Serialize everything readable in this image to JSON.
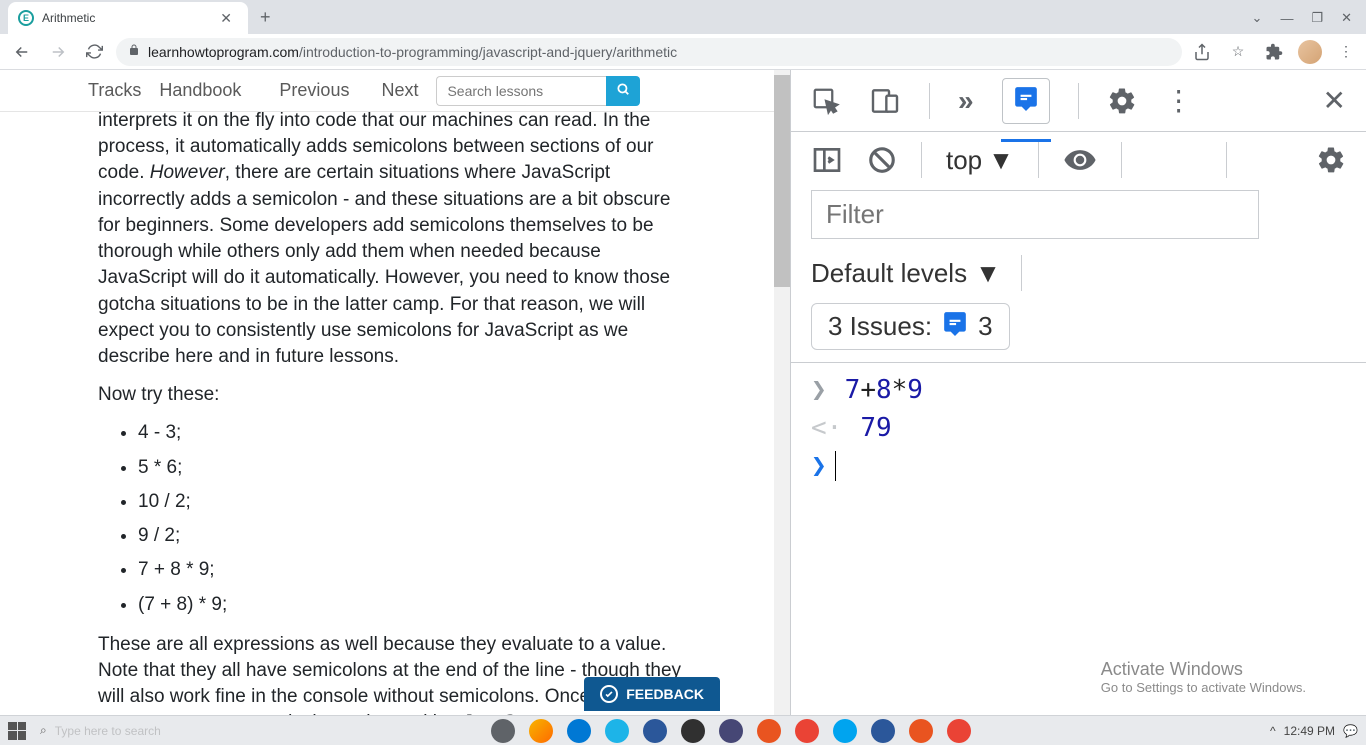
{
  "browser": {
    "tab_title": "Arithmetic",
    "url_domain": "learnhowtoprogram.com",
    "url_path": "/introduction-to-programming/javascript-and-jquery/arithmetic"
  },
  "site_nav": {
    "tracks": "Tracks",
    "handbook": "Handbook",
    "previous": "Previous",
    "next": "Next",
    "search_placeholder": "Search lessons"
  },
  "article": {
    "p1_a": "interprets it on the fly into code that our machines can read. In the process, it automatically adds semicolons between sections of our code. ",
    "p1_em": "However",
    "p1_b": ", there are certain situations where JavaScript incorrectly adds a semicolon - and these situations are a bit obscure for beginners. Some developers add semicolons themselves to be thorough while others only add them when needed because JavaScript will do it automatically. However, you need to know those gotcha situations to be in the latter camp. For that reason, we will expect you to consistently use semicolons for JavaScript as we describe here and in future lessons.",
    "p2": "Now try these:",
    "items": [
      "4 - 3;",
      "5 * 6;",
      "10 / 2;",
      "9 / 2;",
      "7 + 8 * 9;",
      "(7 + 8) * 9;"
    ],
    "p3": "These are all expressions as well because they evaluate to a value. Note that they all have semicolons at the end of the line - though they will also work fine in the console without semicolons. Once again, we expect you to use semicolons when writing JavaSc"
  },
  "feedback": {
    "label": "FEEDBACK"
  },
  "devtools": {
    "context": "top",
    "filter_placeholder": "Filter",
    "levels": "Default levels",
    "issues_label": "3 Issues:",
    "issues_count": "3",
    "input_expr": {
      "a": "7",
      "op1": "+",
      "b": "8",
      "op2": "*",
      "c": "9"
    },
    "result": "79"
  },
  "activate": {
    "title": "Activate Windows",
    "sub": "Go to Settings to activate Windows."
  },
  "taskbar": {
    "search": "Type here to search",
    "time": "12:49 PM"
  }
}
